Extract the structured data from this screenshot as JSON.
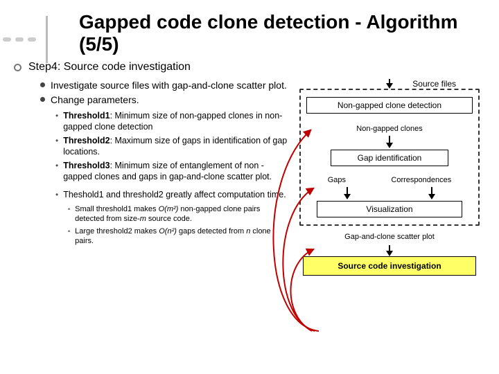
{
  "title": "Gapped code clone detection - Algorithm (5/5)",
  "top_label": "Source files",
  "step4": "Step4: Source code investigation",
  "sub1": {
    "a": "Investigate source files with gap-and-clone scatter plot.",
    "b": "Change parameters."
  },
  "thresholds": {
    "t1_label": "Threshold1",
    "t1_text": ": Minimum size of non-gapped clones in non-gapped clone detection",
    "t2_label": "Threshold2",
    "t2_text": ": Maximum size of gaps in identification of gap locations.",
    "t3_label": "Threshold3",
    "t3_text": ": Minimum size of entanglement of non -gapped clones and gaps in gap-and-clone scatter plot."
  },
  "affect_line": "Theshold1 and threshold2 greatly affect computation time.",
  "sub3": {
    "a_pre": "Small threshold1 makes ",
    "a_expr": "O(m²)",
    "a_post": " non-gapped clone pairs detected from size-",
    "a_var": "m",
    "a_tail": " source code.",
    "b_pre": "Large threshold2 makes ",
    "b_expr": "O(n²)",
    "b_post": " gaps detected from ",
    "b_var": "n",
    "b_tail": " clone pairs."
  },
  "diagram": {
    "nongapped_box": "Non-gapped clone detection",
    "nongapped_label": "Non-gapped clones",
    "gapid_box": "Gap identification",
    "gaps_label": "Gaps",
    "corr_label": "Correspondences",
    "viz_box": "Visualization",
    "scatter_label": "Gap-and-clone scatter plot",
    "yellow_box": "Source code investigation"
  }
}
